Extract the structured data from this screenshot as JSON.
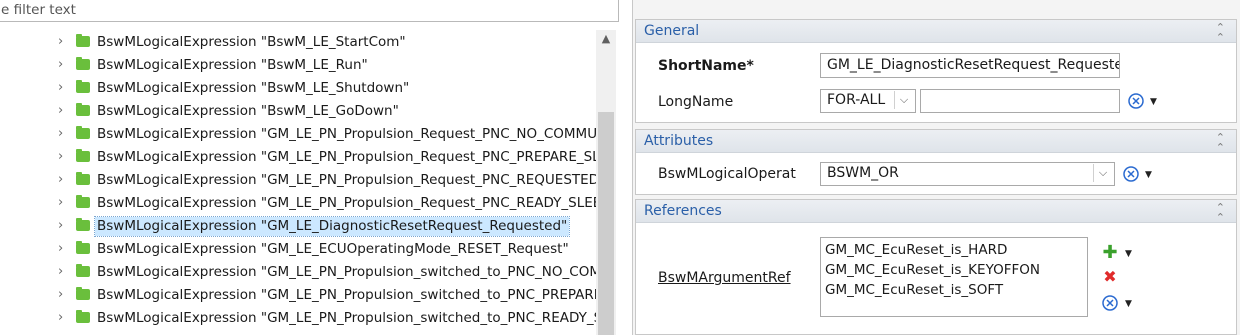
{
  "filter": {
    "placeholder": "e filter text"
  },
  "tree": {
    "items": [
      {
        "label": "BswMLogicalExpression \"BswM_LE_StartCom\"",
        "selected": false
      },
      {
        "label": "BswMLogicalExpression \"BswM_LE_Run\"",
        "selected": false
      },
      {
        "label": "BswMLogicalExpression \"BswM_LE_Shutdown\"",
        "selected": false
      },
      {
        "label": "BswMLogicalExpression \"BswM_LE_GoDown\"",
        "selected": false
      },
      {
        "label": "BswMLogicalExpression \"GM_LE_PN_Propulsion_Request_PNC_NO_COMMUN",
        "selected": false
      },
      {
        "label": "BswMLogicalExpression \"GM_LE_PN_Propulsion_Request_PNC_PREPARE_SLE",
        "selected": false
      },
      {
        "label": "BswMLogicalExpression \"GM_LE_PN_Propulsion_Request_PNC_REQUESTED\"",
        "selected": false
      },
      {
        "label": "BswMLogicalExpression \"GM_LE_PN_Propulsion_Request_PNC_READY_SLEEP",
        "selected": false
      },
      {
        "label": "BswMLogicalExpression \"GM_LE_DiagnosticResetRequest_Requested\"",
        "selected": true
      },
      {
        "label": "BswMLogicalExpression \"GM_LE_ECUOperatingMode_RESET_Request\"",
        "selected": false
      },
      {
        "label": "BswMLogicalExpression \"GM_LE_PN_Propulsion_switched_to_PNC_NO_COMM",
        "selected": false
      },
      {
        "label": "BswMLogicalExpression \"GM_LE_PN_Propulsion_switched_to_PNC_PREPARE_",
        "selected": false
      },
      {
        "label": "BswMLogicalExpression \"GM_LE_PN_Propulsion_switched_to_PNC_READY_SL",
        "selected": false
      }
    ]
  },
  "general": {
    "title": "General",
    "shortname_label": "ShortName*",
    "shortname_value": "GM_LE_DiagnosticResetRequest_Requested",
    "longname_label": "LongName",
    "longname_lang": "FOR-ALL",
    "longname_value": ""
  },
  "attributes": {
    "title": "Attributes",
    "operator_label": "BswMLogicalOperat",
    "operator_value": "BSWM_OR"
  },
  "references": {
    "title": "References",
    "argref_label": "BswMArgumentRef",
    "argref_items": [
      "GM_MC_EcuReset_is_HARD",
      "GM_MC_EcuReset_is_KEYOFFON",
      "GM_MC_EcuReset_is_SOFT"
    ]
  },
  "colors": {
    "accent": "#2a5fa8",
    "selection": "#cce8ff",
    "folder": "#6abf3c",
    "add": "#3aa12c",
    "remove": "#e02b2b"
  }
}
